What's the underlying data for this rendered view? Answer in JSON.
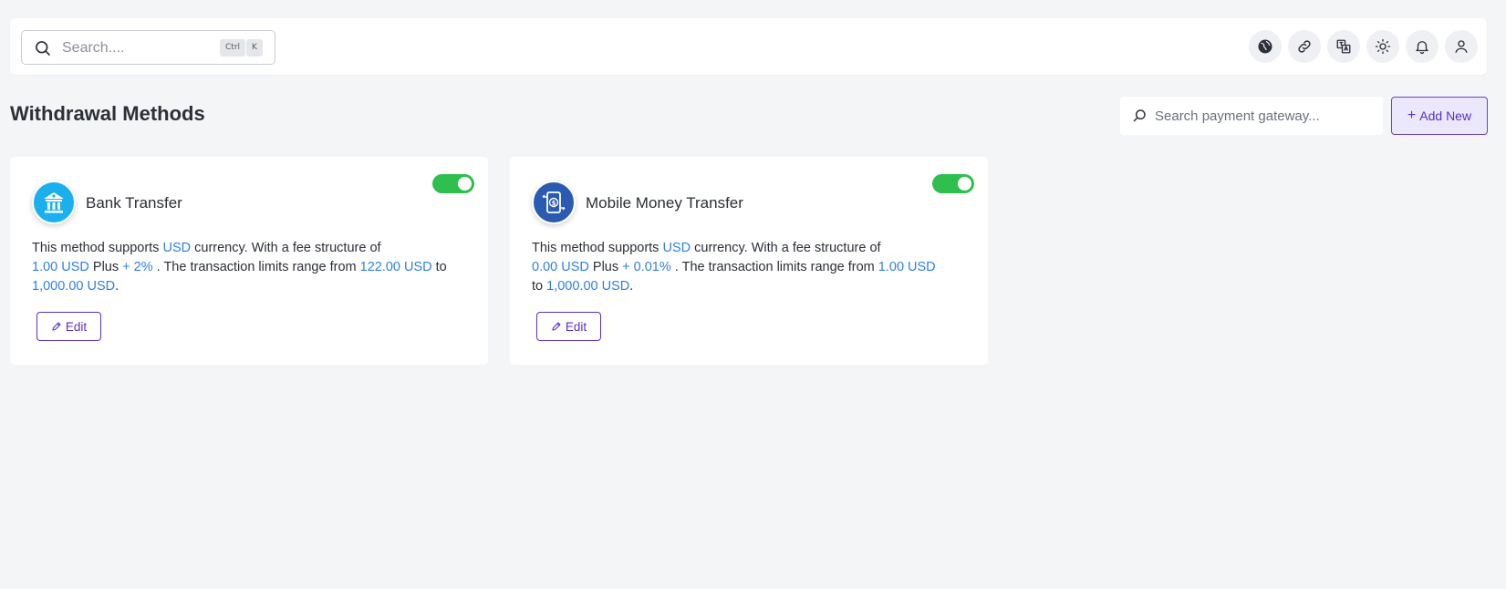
{
  "topbar": {
    "search_placeholder": "Search....",
    "shortcut_ctrl": "Ctrl",
    "shortcut_key": "K",
    "tools": [
      "globe-icon",
      "link-icon",
      "translate-icon",
      "sun-icon",
      "bell-icon",
      "user-icon"
    ]
  },
  "page": {
    "title": "Withdrawal Methods",
    "gateway_search_placeholder": "Search payment gateway...",
    "add_new_label": "Add New"
  },
  "colors": {
    "accent": "#5b2fc2",
    "highlight": "#2f7fe6",
    "toggle_on": "#2fbf4f",
    "bank_logo": "#1ab0ee",
    "mobile_logo": "#2a5bb0"
  },
  "methods": [
    {
      "name": "Bank Transfer",
      "logo": "bank-icon",
      "enabled": true,
      "text_supports": "This method supports",
      "currency": "USD",
      "text_fee": "currency. With a fee structure of",
      "fixed_fee": "1.00 USD",
      "text_plus": "Plus",
      "percent_fee": "+ 2%",
      "text_limits": ". The transaction limits range from",
      "min_limit": "122.00 USD",
      "text_to": "to",
      "max_limit": "1,000.00 USD",
      "text_end": ".",
      "edit_label": "Edit"
    },
    {
      "name": "Mobile Money Transfer",
      "logo": "mobile-money-icon",
      "enabled": true,
      "text_supports": "This method supports",
      "currency": "USD",
      "text_fee": "currency. With a fee structure of",
      "fixed_fee": "0.00 USD",
      "text_plus": "Plus",
      "percent_fee": "+ 0.01%",
      "text_limits": ". The transaction limits range from",
      "min_limit": "1.00 USD",
      "text_to": "to",
      "max_limit": "1,000.00 USD",
      "text_end": ".",
      "edit_label": "Edit"
    }
  ]
}
